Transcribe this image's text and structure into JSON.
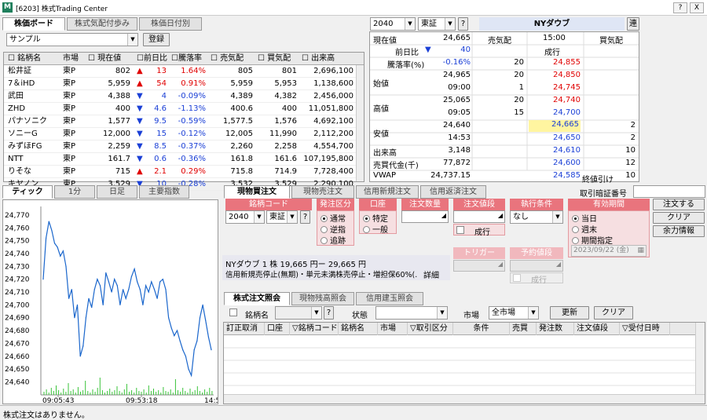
{
  "window": {
    "title": "[6203] 株式Trading Center",
    "help_btn": "?",
    "close_btn": "X"
  },
  "board": {
    "tabs": [
      "株価ボード",
      "株式気配付歩み",
      "株価日付別"
    ],
    "list_select": "サンプル",
    "register_btn": "登録",
    "headers": [
      "銘柄名",
      "市場",
      "現在値",
      "前日比",
      "騰落率",
      "売気配",
      "買気配",
      "出来高"
    ],
    "rows": [
      {
        "name": "松井証",
        "mkt": "東P",
        "price": "802",
        "dir": "up",
        "chg": "13",
        "pct": "1.64%",
        "ask": "805",
        "bid": "801",
        "vol": "2,696,100"
      },
      {
        "name": "7＆iHD",
        "mkt": "東P",
        "price": "5,959",
        "dir": "up",
        "chg": "54",
        "pct": "0.91%",
        "ask": "5,959",
        "bid": "5,953",
        "vol": "1,138,600"
      },
      {
        "name": "武田",
        "mkt": "東P",
        "price": "4,388",
        "dir": "down",
        "chg": "4",
        "pct": "-0.09%",
        "ask": "4,389",
        "bid": "4,382",
        "vol": "2,456,000"
      },
      {
        "name": "ZHD",
        "mkt": "東P",
        "price": "400",
        "dir": "down",
        "chg": "4.6",
        "pct": "-1.13%",
        "ask": "400.6",
        "bid": "400",
        "vol": "11,051,800"
      },
      {
        "name": "パナソニク",
        "mkt": "東P",
        "price": "1,577",
        "dir": "down",
        "chg": "9.5",
        "pct": "-0.59%",
        "ask": "1,577.5",
        "bid": "1,576",
        "vol": "4,692,100"
      },
      {
        "name": "ソニーG",
        "mkt": "東P",
        "price": "12,000",
        "dir": "down",
        "chg": "15",
        "pct": "-0.12%",
        "ask": "12,005",
        "bid": "11,990",
        "vol": "2,112,200"
      },
      {
        "name": "みずほFG",
        "mkt": "東P",
        "price": "2,259",
        "dir": "down",
        "chg": "8.5",
        "pct": "-0.37%",
        "ask": "2,260",
        "bid": "2,258",
        "vol": "4,554,700"
      },
      {
        "name": "NTT",
        "mkt": "東P",
        "price": "161.7",
        "dir": "down",
        "chg": "0.6",
        "pct": "-0.36%",
        "ask": "161.8",
        "bid": "161.6",
        "vol": "107,195,800"
      },
      {
        "name": "りそな",
        "mkt": "東P",
        "price": "715",
        "dir": "up",
        "chg": "2.1",
        "pct": "0.29%",
        "ask": "715.8",
        "bid": "714.9",
        "vol": "7,728,400"
      },
      {
        "name": "キヤノン",
        "mkt": "東P",
        "price": "3,529",
        "dir": "down",
        "chg": "10",
        "pct": "-0.28%",
        "ask": "3,532",
        "bid": "3,529",
        "vol": "2,290,100"
      }
    ]
  },
  "quote": {
    "code": "2040",
    "market": "東証",
    "q": "?",
    "index_name": "NYダウブ",
    "link_btn": "連",
    "labels": {
      "price": "現在値",
      "prev": "前日比",
      "pct": "騰落率(%)",
      "open": "始値",
      "high": "高値",
      "low": "安値",
      "volume": "出来高",
      "value": "売買代金(千)",
      "vwap": "VWAP"
    },
    "price": "24,665",
    "prev": "40",
    "pct": "-0.16%",
    "open": "24,965",
    "open_time": "09:00",
    "high": "25,065",
    "high_time": "09:05",
    "low": "24,640",
    "low_time": "14:53",
    "volume": "3,148",
    "value": "77,872",
    "vwap": "24,737.15",
    "book_headers": [
      "売気配",
      "15:00",
      "買気配"
    ],
    "market_order": "成行",
    "book": [
      {
        "ask_qty": "20",
        "price": "24,855",
        "bid_qty": "",
        "side": "ask"
      },
      {
        "ask_qty": "20",
        "price": "24,850",
        "bid_qty": "",
        "side": "ask"
      },
      {
        "ask_qty": "1",
        "price": "24,745",
        "bid_qty": "",
        "side": "ask"
      },
      {
        "ask_qty": "20",
        "price": "24,740",
        "bid_qty": "",
        "side": "ask"
      },
      {
        "ask_qty": "15",
        "price": "24,700",
        "bid_qty": "",
        "side": "bid"
      },
      {
        "ask_qty": "",
        "price": "24,665",
        "bid_qty": "2",
        "side": "cur"
      },
      {
        "ask_qty": "",
        "price": "24,650",
        "bid_qty": "2",
        "side": "bid"
      },
      {
        "ask_qty": "",
        "price": "24,610",
        "bid_qty": "10",
        "side": "bid"
      },
      {
        "ask_qty": "",
        "price": "24,600",
        "bid_qty": "12",
        "side": "bid"
      },
      {
        "ask_qty": "",
        "price": "24,585",
        "bid_qty": "10",
        "side": "bid"
      }
    ],
    "closing_note": "終値引け"
  },
  "chart_tabs": [
    "ティック",
    "1分",
    "日足",
    "主要指数"
  ],
  "chart_data": {
    "type": "line",
    "title": "",
    "ylabel": "",
    "yticks": [
      "24,770",
      "24,760",
      "24,750",
      "24,740",
      "24,730",
      "24,720",
      "24,710",
      "24,700",
      "24,690",
      "24,680",
      "24,670",
      "24,660",
      "24,650",
      "24,640"
    ],
    "ylim": [
      24636,
      24773
    ],
    "xticks": [
      "09:05:43",
      "09:53:18",
      "14:5"
    ],
    "series": [
      {
        "values": [
          24720,
          24752,
          24765,
          24758,
          24748,
          24745,
          24738,
          24742,
          24730,
          24705,
          24712,
          24690,
          24700,
          24660,
          24668,
          24690,
          24705,
          24698,
          24712,
          24720,
          24715,
          24700,
          24725,
          24718,
          24710,
          24720,
          24715,
          24700,
          24712,
          24705,
          24712,
          24722,
          24728,
          24718,
          24712,
          24700,
          24715,
          24710,
          24718,
          24712,
          24705,
          24718,
          24720,
          24712,
          24690,
          24682,
          24676,
          24680,
          24672,
          24665,
          24660,
          24650,
          24645,
          24665,
          24672,
          24690,
          24700,
          24688,
          24675,
          24665
        ]
      }
    ]
  },
  "order": {
    "tabs": [
      "現物買注文",
      "現物売注文",
      "信用新規注文",
      "信用返済注文"
    ],
    "pin_label": "取引暗証番号",
    "headers": {
      "code": "銘柄コード",
      "type": "発注区分",
      "account": "口座",
      "qty": "注文数量",
      "price": "注文値段",
      "exec": "執行条件",
      "period": "有効期間"
    },
    "code": "2040",
    "market": "東証",
    "q": "?",
    "types": [
      "通常",
      "逆指",
      "追跡"
    ],
    "accounts": [
      "特定",
      "一般"
    ],
    "market_order": "成行",
    "exec_value": "なし",
    "periods": [
      "当日",
      "週末",
      "期間指定"
    ],
    "date": "2023/09/22 (金)",
    "trigger": "トリガー",
    "scheduled": "予約値段",
    "info1": "NYダウブ   1 株   19,665 円ー   29,665 円",
    "info2": "信用新規売停止(無期)・単元未満株売停止・増担保60%(...",
    "detail": "詳細",
    "buttons": [
      "注文する",
      "クリア",
      "余力情報"
    ]
  },
  "inquiry": {
    "tabs": [
      "株式注文照会",
      "現物残高照会",
      "信用建玉照会"
    ],
    "name_label": "銘柄名",
    "q": "?",
    "status_label": "状態",
    "market_label": "市場",
    "market_value": "全市場",
    "update_btn": "更新",
    "clear_btn": "クリア",
    "headers": [
      "訂正取消",
      "口座",
      "銘柄コード",
      "銘柄名",
      "市場",
      "取引区分",
      "条件",
      "売買",
      "発注数",
      "注文値段",
      "受付日時"
    ]
  },
  "status": "株式注文はありません。"
}
